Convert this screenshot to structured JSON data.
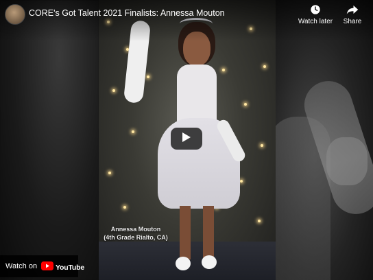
{
  "video": {
    "title": "CORE's Got Talent 2021 Finalists: Annessa Mouton",
    "caption_line1": "Annessa Mouton",
    "caption_line2": "(4th Grade Rialto, CA)"
  },
  "actions": {
    "watch_later_label": "Watch later",
    "share_label": "Share"
  },
  "bottom_bar": {
    "watch_on_label": "Watch on",
    "brand_label": "YouTube"
  },
  "icons": {
    "avatar": "channel-avatar",
    "watch_later": "clock-icon",
    "share": "share-arrow-icon",
    "play": "play-icon",
    "brand": "youtube-logo-icon"
  },
  "colors": {
    "play_button_bg": "#212121",
    "brand_red": "#ff0000",
    "text": "#ffffff"
  }
}
